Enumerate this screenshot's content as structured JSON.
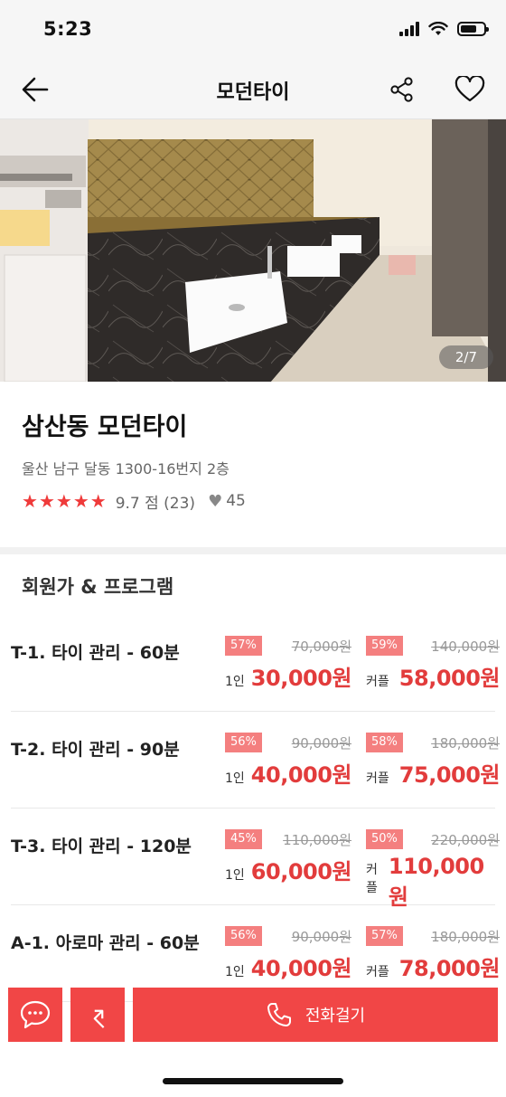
{
  "status": {
    "time": "5:23",
    "battery_level": 0.7
  },
  "header": {
    "title": "모던타이"
  },
  "gallery": {
    "counter": "2/7"
  },
  "shop": {
    "name": "삼산동 모던타이",
    "address": "울산 남구 달동 1300-16번지 2층",
    "stars": 5,
    "score": "9.7 점 (23)",
    "likes": "45"
  },
  "section": {
    "title": "회원가 & 프로그램"
  },
  "programs": [
    {
      "name": "T-1. 타이 관리 - 60분",
      "single": {
        "badge": "57%",
        "original": "70,000원",
        "unit": "1인",
        "price": "30,000원"
      },
      "couple": {
        "badge": "59%",
        "original": "140,000원",
        "unit": "커플",
        "price": "58,000원"
      }
    },
    {
      "name": "T-2. 타이 관리 - 90분",
      "single": {
        "badge": "56%",
        "original": "90,000원",
        "unit": "1인",
        "price": "40,000원"
      },
      "couple": {
        "badge": "58%",
        "original": "180,000원",
        "unit": "커플",
        "price": "75,000원"
      }
    },
    {
      "name": "T-3. 타이 관리 - 120분",
      "single": {
        "badge": "45%",
        "original": "110,000원",
        "unit": "1인",
        "price": "60,000원"
      },
      "couple": {
        "badge": "50%",
        "original": "220,000원",
        "unit": "커플",
        "price": "110,000원"
      }
    },
    {
      "name": "A-1. 아로마 관리 - 60분",
      "single": {
        "badge": "56%",
        "original": "90,000원",
        "unit": "1인",
        "price": "40,000원"
      },
      "couple": {
        "badge": "57%",
        "original": "180,000원",
        "unit": "커플",
        "price": "78,000원"
      }
    }
  ],
  "bottom_bar": {
    "call_label": "전화걸기"
  },
  "colors": {
    "accent": "#f14646",
    "price_red": "#e23c3c",
    "badge": "#f47f7f"
  },
  "icons": [
    "back-arrow-icon",
    "share-icon",
    "heart-icon",
    "star-icon",
    "chat-bubble-icon",
    "share-arrow-icon",
    "phone-icon"
  ]
}
